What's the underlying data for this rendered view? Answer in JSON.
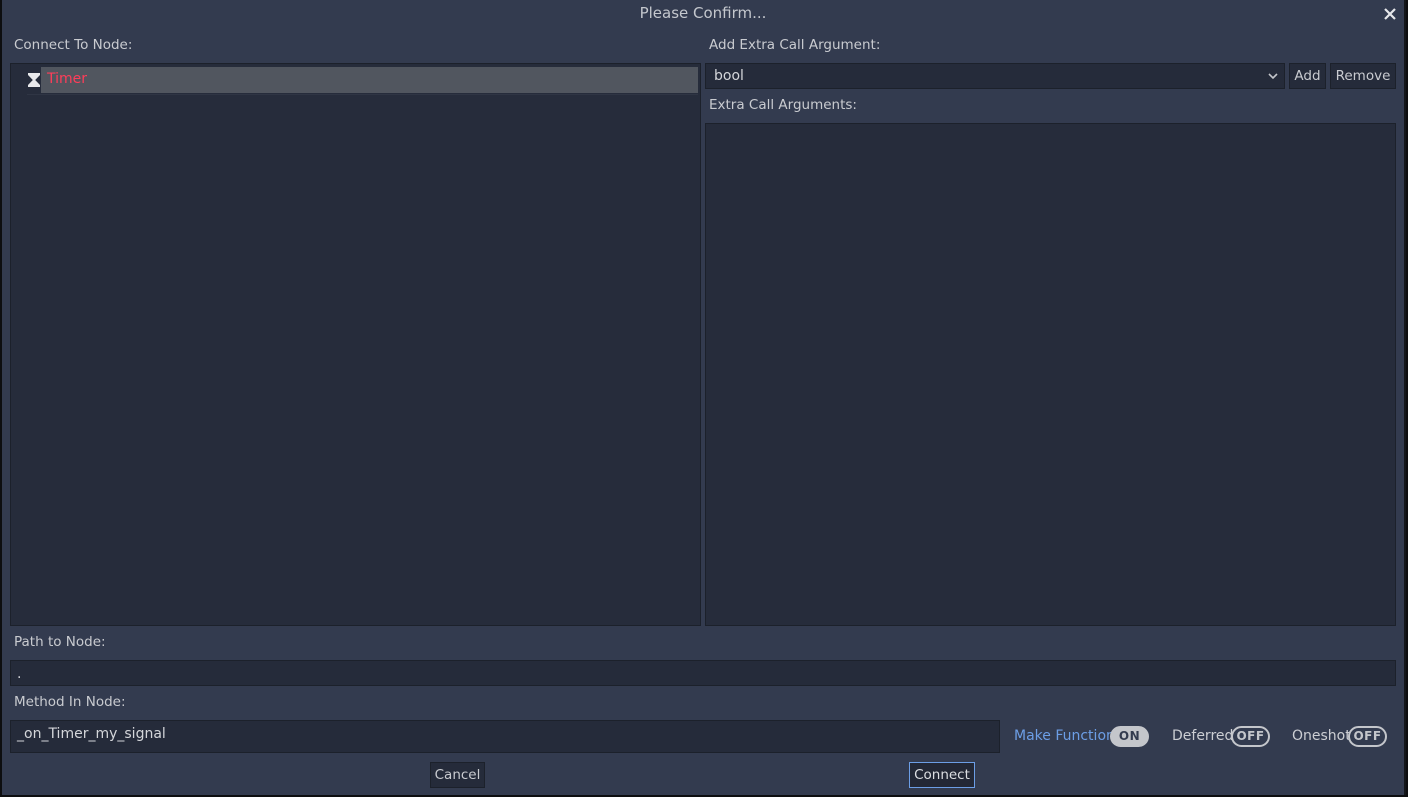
{
  "dialog": {
    "title": "Please Confirm...",
    "close_icon": "close-icon"
  },
  "left": {
    "connect_label": "Connect To Node:",
    "tree": [
      {
        "name": "Timer",
        "icon": "hourglass-icon",
        "selected": true,
        "color": "#ff3d59"
      }
    ]
  },
  "right": {
    "add_arg_label": "Add Extra Call Argument:",
    "type_select": {
      "value": "bool"
    },
    "add_button": "Add",
    "remove_button": "Remove",
    "extra_args_label": "Extra Call Arguments:",
    "extra_args": []
  },
  "path": {
    "label": "Path to Node:",
    "value": "."
  },
  "method": {
    "label": "Method In Node:",
    "value": "_on_Timer_my_signal"
  },
  "toggles": [
    {
      "label": "Make Function",
      "state": "ON",
      "accent": "#6c9ee6"
    },
    {
      "label": "Deferred",
      "state": "OFF"
    },
    {
      "label": "Oneshot",
      "state": "OFF"
    }
  ],
  "buttons": {
    "cancel": "Cancel",
    "connect": "Connect"
  }
}
